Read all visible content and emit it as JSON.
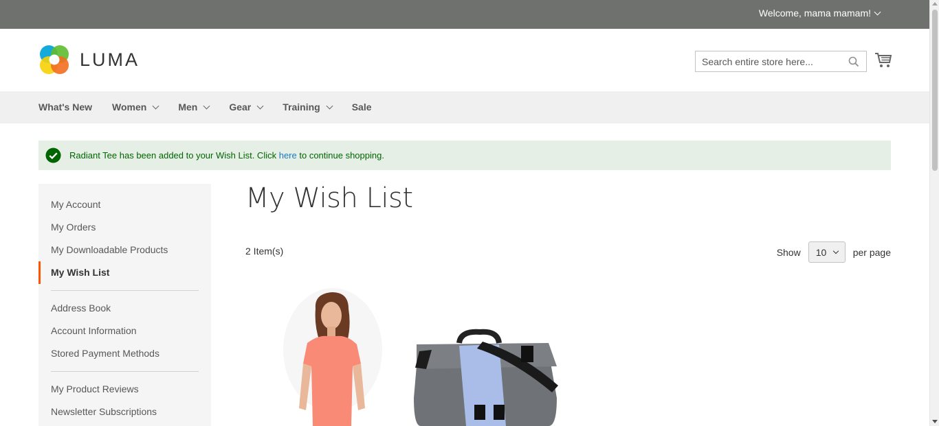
{
  "topbar": {
    "welcome_text": "Welcome, mama mamam!"
  },
  "header": {
    "logo_text": "LUMA",
    "search_placeholder": "Search entire store here..."
  },
  "nav": {
    "items": [
      {
        "label": "What's New",
        "has_dropdown": false
      },
      {
        "label": "Women",
        "has_dropdown": true
      },
      {
        "label": "Men",
        "has_dropdown": true
      },
      {
        "label": "Gear",
        "has_dropdown": true
      },
      {
        "label": "Training",
        "has_dropdown": true
      },
      {
        "label": "Sale",
        "has_dropdown": false
      }
    ]
  },
  "message": {
    "prefix": "Radiant Tee has been added to your Wish List. Click ",
    "link": "here",
    "suffix": " to continue shopping."
  },
  "sidebar": {
    "items": [
      {
        "label": "My Account"
      },
      {
        "label": "My Orders"
      },
      {
        "label": "My Downloadable Products"
      },
      {
        "label": "My Wish List",
        "active": true
      },
      {
        "label": "Address Book"
      },
      {
        "label": "Account Information"
      },
      {
        "label": "Stored Payment Methods"
      },
      {
        "label": "My Product Reviews"
      },
      {
        "label": "Newsletter Subscriptions"
      }
    ]
  },
  "main": {
    "title": "My Wish List",
    "count": "2 Item(s)",
    "show_label": "Show",
    "per_page_value": "10",
    "per_page_label": "per page"
  },
  "colors": {
    "topbar": "#6e716e",
    "nav_bg": "#f0f0f0",
    "message_bg": "#e5efe5",
    "message_text": "#006400",
    "link": "#1979c3",
    "active_marker": "#ff5501"
  }
}
